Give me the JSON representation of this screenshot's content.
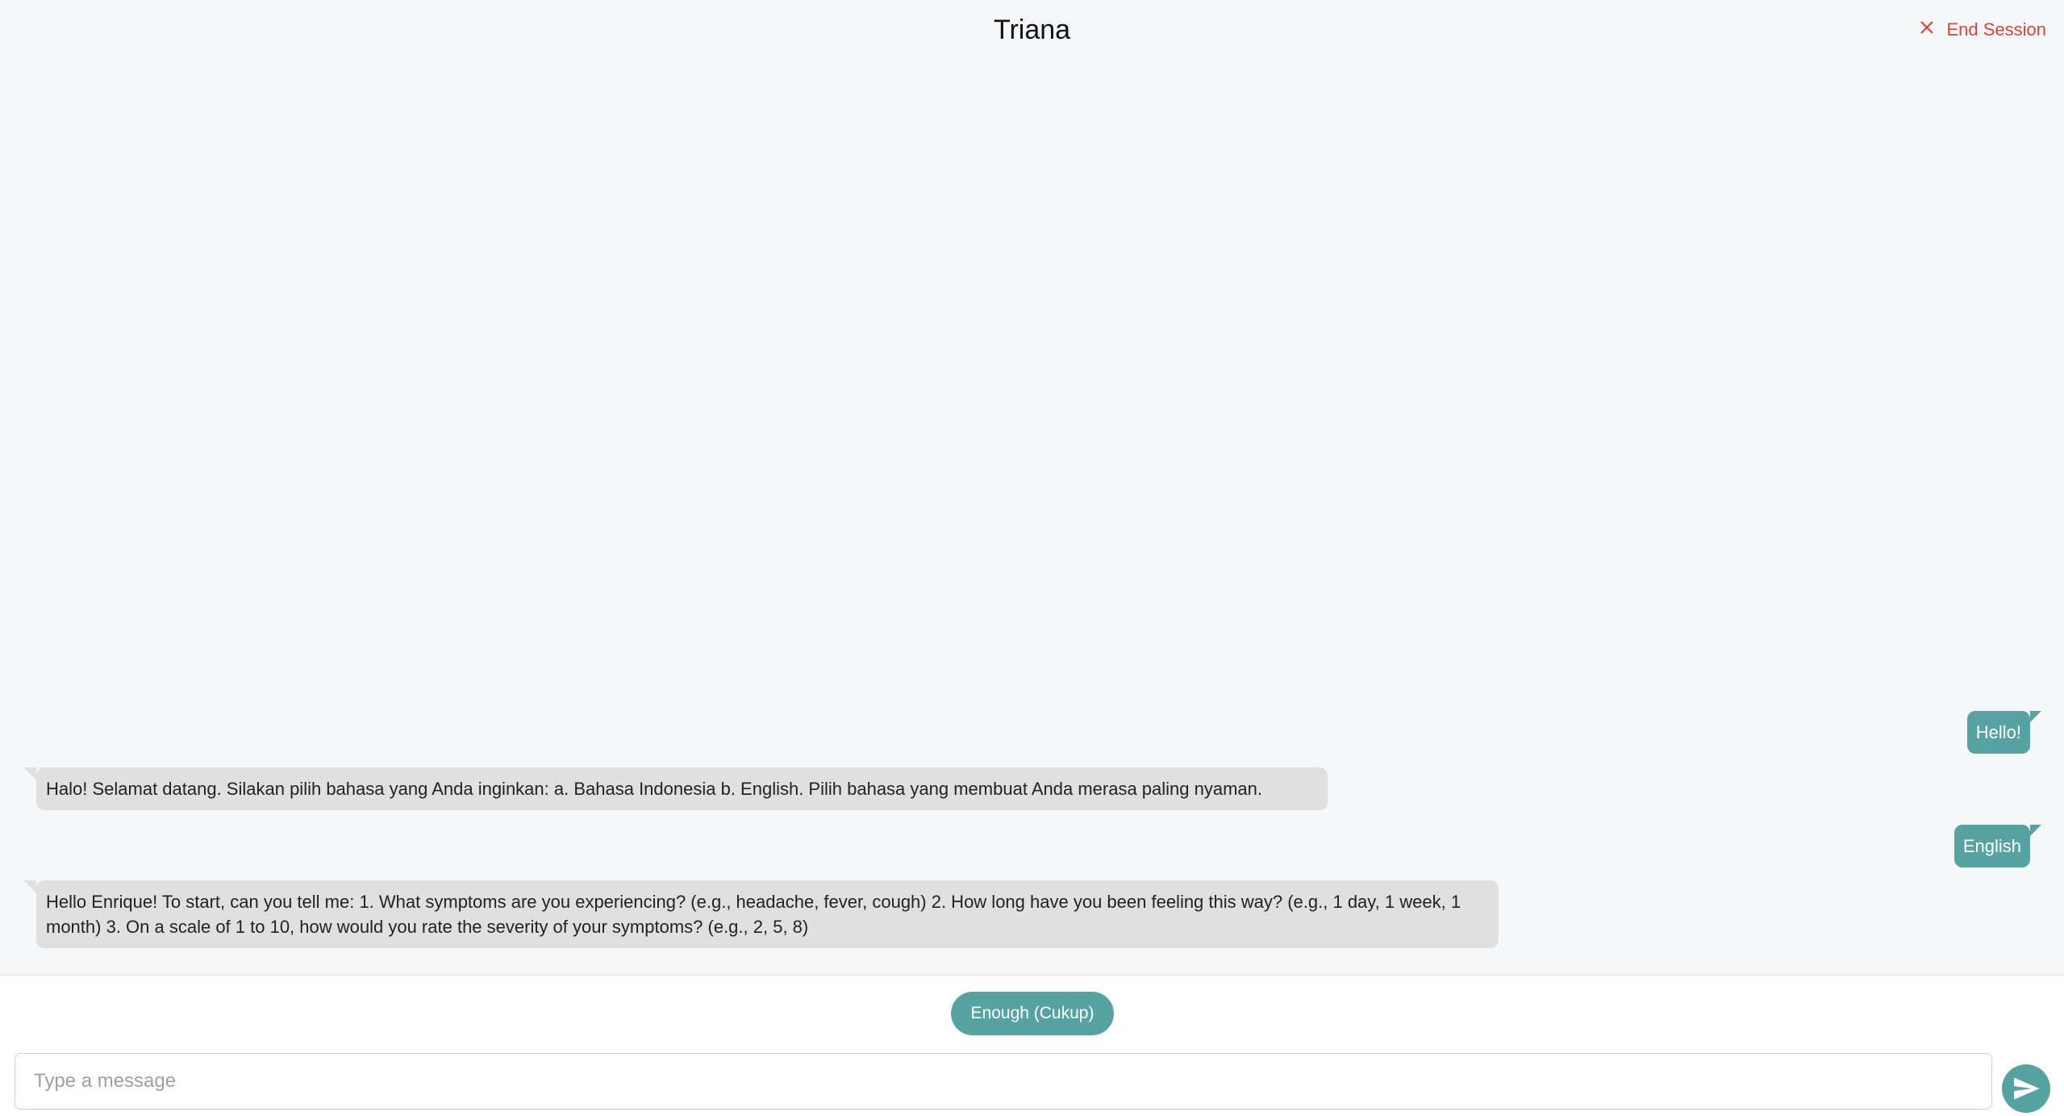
{
  "header": {
    "title": "Triana",
    "end_session_label": "End Session"
  },
  "messages": [
    {
      "sender": "user",
      "text": "Hello!"
    },
    {
      "sender": "bot",
      "text": "Halo! Selamat datang. Silakan pilih bahasa yang Anda inginkan: a. Bahasa Indonesia b. English. Pilih bahasa yang membuat Anda merasa paling nyaman."
    },
    {
      "sender": "user",
      "text": "English"
    },
    {
      "sender": "bot",
      "text": "Hello Enrique! To start, can you tell me: 1. What symptoms are you experiencing? (e.g., headache, fever, cough) 2. How long have you been feeling this way? (e.g., 1 day, 1 week, 1 month) 3. On a scale of 1 to 10, how would you rate the severity of your symptoms? (e.g., 2, 5, 8)"
    }
  ],
  "quick_reply": {
    "label": "Enough (Cukup)"
  },
  "composer": {
    "placeholder": "Type a message",
    "value": ""
  },
  "colors": {
    "accent": "#57a3a3",
    "bot_bubble": "#e0e0e0",
    "end_session": "#d9443a",
    "background": "#f6f7f9"
  },
  "icons": {
    "end_session": "close-icon",
    "send": "send-icon"
  }
}
